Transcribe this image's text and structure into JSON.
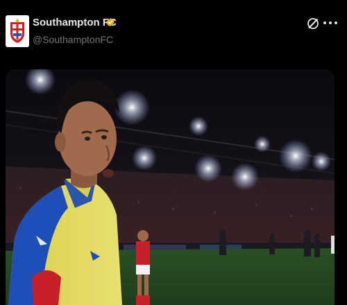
{
  "post": {
    "account": {
      "display_name": "Southampton FC",
      "handle": "@SouthamptonFC",
      "verified": true,
      "verified_badge_color": "#e2b719"
    },
    "icons": {
      "grok": "grok-icon",
      "more": "more-icon",
      "verified": "verified-badge-icon"
    },
    "media": {
      "type": "photo"
    }
  },
  "colors": {
    "background": "#000000",
    "text_primary": "#e7e9ea",
    "text_secondary": "#71767b",
    "pitch": "#2f5a2a"
  }
}
